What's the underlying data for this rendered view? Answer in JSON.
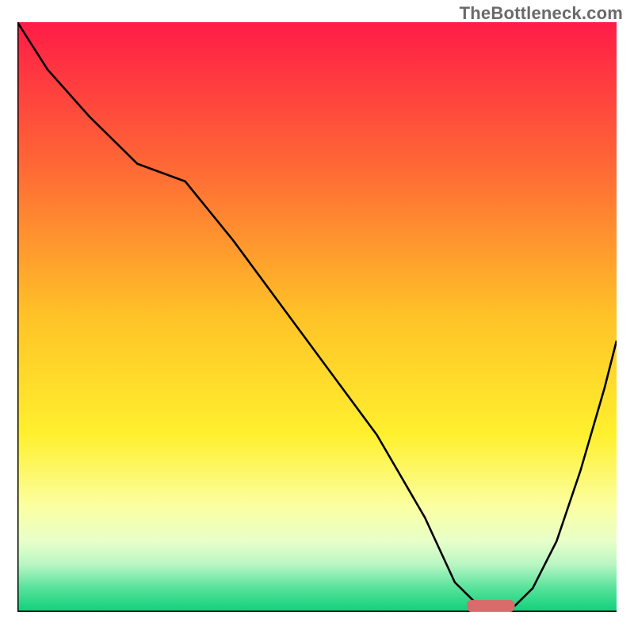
{
  "watermark": "TheBottleneck.com",
  "chart_data": {
    "type": "line",
    "title": "",
    "xlabel": "",
    "ylabel": "",
    "xlim": [
      0,
      100
    ],
    "ylim": [
      0,
      100
    ],
    "legend": null,
    "annotations": [
      "TheBottleneck.com"
    ],
    "gradient_background": {
      "orientation": "vertical",
      "stops": [
        {
          "pos": 0.0,
          "color": "#ff1c47"
        },
        {
          "pos": 0.25,
          "color": "#ff6a35"
        },
        {
          "pos": 0.5,
          "color": "#ffc327"
        },
        {
          "pos": 0.7,
          "color": "#fff02e"
        },
        {
          "pos": 0.82,
          "color": "#fbffa0"
        },
        {
          "pos": 0.88,
          "color": "#e8ffc9"
        },
        {
          "pos": 0.92,
          "color": "#b8f6c4"
        },
        {
          "pos": 0.96,
          "color": "#56e29a"
        },
        {
          "pos": 1.0,
          "color": "#0fd07a"
        }
      ]
    },
    "series": [
      {
        "name": "bottleneck-curve",
        "x": [
          0,
          5,
          12,
          20,
          28,
          36,
          44,
          52,
          60,
          68,
          73,
          77,
          80,
          83,
          86,
          90,
          94,
          98,
          100
        ],
        "y": [
          100,
          92,
          84,
          76,
          73,
          63,
          52,
          41,
          30,
          16,
          5,
          1,
          1,
          1,
          4,
          12,
          24,
          38,
          46
        ]
      }
    ],
    "marker": {
      "name": "optimal-range",
      "shape": "rounded-bar",
      "color": "#da6b6b",
      "x_center": 79,
      "y": 1,
      "width": 8,
      "height": 2
    }
  }
}
